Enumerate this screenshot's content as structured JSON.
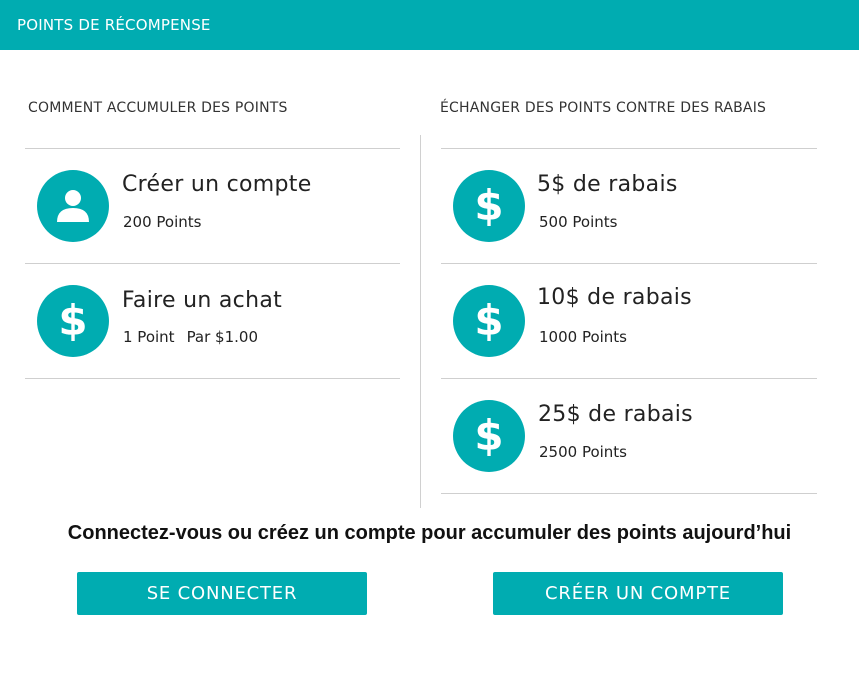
{
  "header": {
    "title": "POINTS DE RÉCOMPENSE"
  },
  "earn": {
    "heading": "COMMENT ACCUMULER DES POINTS",
    "items": [
      {
        "icon": "user-icon",
        "title": "Créer un compte",
        "points": "200 Points"
      },
      {
        "icon": "dollar-icon",
        "title": "Faire un achat",
        "points": "1 Point",
        "per": "Par $1.00"
      }
    ]
  },
  "redeem": {
    "heading": "ÉCHANGER DES POINTS CONTRE DES RABAIS",
    "items": [
      {
        "icon": "dollar-icon",
        "title": "5$ de rabais",
        "points": "500 Points"
      },
      {
        "icon": "dollar-icon",
        "title": "10$ de rabais",
        "points": "1000 Points"
      },
      {
        "icon": "dollar-icon",
        "title": "25$ de rabais",
        "points": "2500 Points"
      }
    ]
  },
  "cta": {
    "message": "Connectez-vous ou créez un compte pour accumuler des points aujourd’hui",
    "login_label": "SE CONNECTER",
    "signup_label": "CRÉER UN COMPTE"
  },
  "colors": {
    "accent": "#00acb1",
    "divider": "#cfcfcf"
  }
}
